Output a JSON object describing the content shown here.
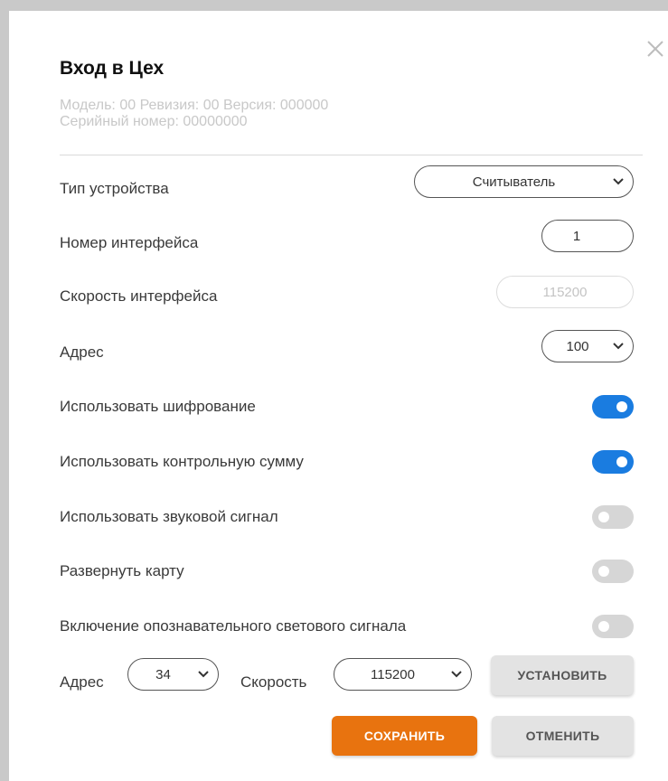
{
  "dialog": {
    "title": "Вход в Цех",
    "meta_line1": "Модель: 00 Ревизия: 00 Версия: 000000",
    "meta_line2": "Серийный номер: 00000000",
    "close_icon": "close-icon"
  },
  "fields": {
    "device_type": {
      "label": "Тип устройства",
      "value": "Считыватель"
    },
    "interface_number": {
      "label": "Номер интерфейса",
      "value": "1"
    },
    "interface_speed": {
      "label": "Скорость интерфейса",
      "value": "115200"
    },
    "address": {
      "label": "Адрес",
      "value": "100"
    }
  },
  "toggles": [
    {
      "label": "Использовать шифрование",
      "on": true
    },
    {
      "label": "Использовать контрольную сумму",
      "on": true
    },
    {
      "label": "Использовать звуковой сигнал",
      "on": false
    },
    {
      "label": "Развернуть карту",
      "on": false
    },
    {
      "label": "Включение опознавательного светового сигнала",
      "on": false
    }
  ],
  "bottom": {
    "address_label": "Адрес",
    "address_value": "34",
    "speed_label": "Скорость",
    "speed_value": "115200",
    "set_button": "УСТАНОВИТЬ"
  },
  "actions": {
    "save": "СОХРАНИТЬ",
    "cancel": "ОТМЕНИТЬ"
  },
  "colors": {
    "accent_blue": "#1a7ce0",
    "accent_orange": "#e8730f",
    "toggle_off": "#d6d6d6"
  }
}
